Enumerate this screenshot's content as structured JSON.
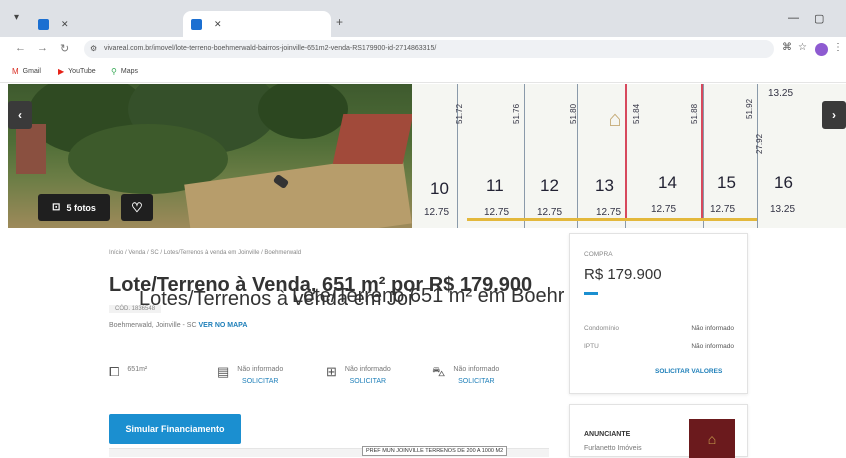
{
  "browser": {
    "tabs": [
      {
        "title": "Lotes/Terrenos à venda em Joi",
        "active": false
      },
      {
        "title": "Lote/Terreno 651 m² em Boehr",
        "active": true
      }
    ],
    "url": "vivareal.com.br/imovel/lote-terreno-boehmerwald-bairros-joinville-651m2-venda-RS179900-id-2714863315/",
    "bookmarks": [
      "Gmail",
      "YouTube",
      "Maps"
    ]
  },
  "gallery": {
    "photos_label": "5 fotos",
    "lots": [
      {
        "number": "10",
        "width": "12.75"
      },
      {
        "number": "11",
        "width": "12.75",
        "length": "51.72"
      },
      {
        "number": "12",
        "width": "12.75",
        "length": "51.76"
      },
      {
        "number": "13",
        "width": "12.75",
        "length": "51.80"
      },
      {
        "number": "14",
        "width": "12.75",
        "length": "51.84"
      },
      {
        "number": "15",
        "width": "12.75",
        "length": "51.88"
      },
      {
        "number": "16",
        "width": "13.25",
        "length": "51.92",
        "top": "13.25",
        "side": "27.92"
      }
    ]
  },
  "listing": {
    "breadcrumb": "Início / Venda / SC / Lotes/Terrenos à venda em Joinville / Boehmerwald",
    "title": "Lote/Terreno à Venda, 651 m² por R$ 179.900",
    "code": "CÓD. 1836548",
    "location": "Boehmerwald, Joinville - SC",
    "map_link": "VER NO MAPA",
    "features": [
      {
        "icon": "area-icon",
        "value": "651m²",
        "action": ""
      },
      {
        "icon": "bedroom-icon",
        "value": "Não informado",
        "action": "SOLICITAR"
      },
      {
        "icon": "bathroom-icon",
        "value": "Não informado",
        "action": "SOLICITAR"
      },
      {
        "icon": "garage-icon",
        "value": "Não informado",
        "action": "SOLICITAR"
      }
    ],
    "simulate_button": "Simular Financiamento",
    "image_caption": "PREF MUN JOINVILLE TERRENOS DE 200 A 1000 M2"
  },
  "price_card": {
    "label": "COMPRA",
    "price": "R$ 179.900",
    "condo_label": "Condomínio",
    "condo_value": "Não informado",
    "iptu_label": "IPTU",
    "iptu_value": "Não informado",
    "request_link": "SOLICITAR VALORES"
  },
  "advertiser": {
    "label": "ANUNCIANTE",
    "name": "Furlanetto Imóveis"
  }
}
